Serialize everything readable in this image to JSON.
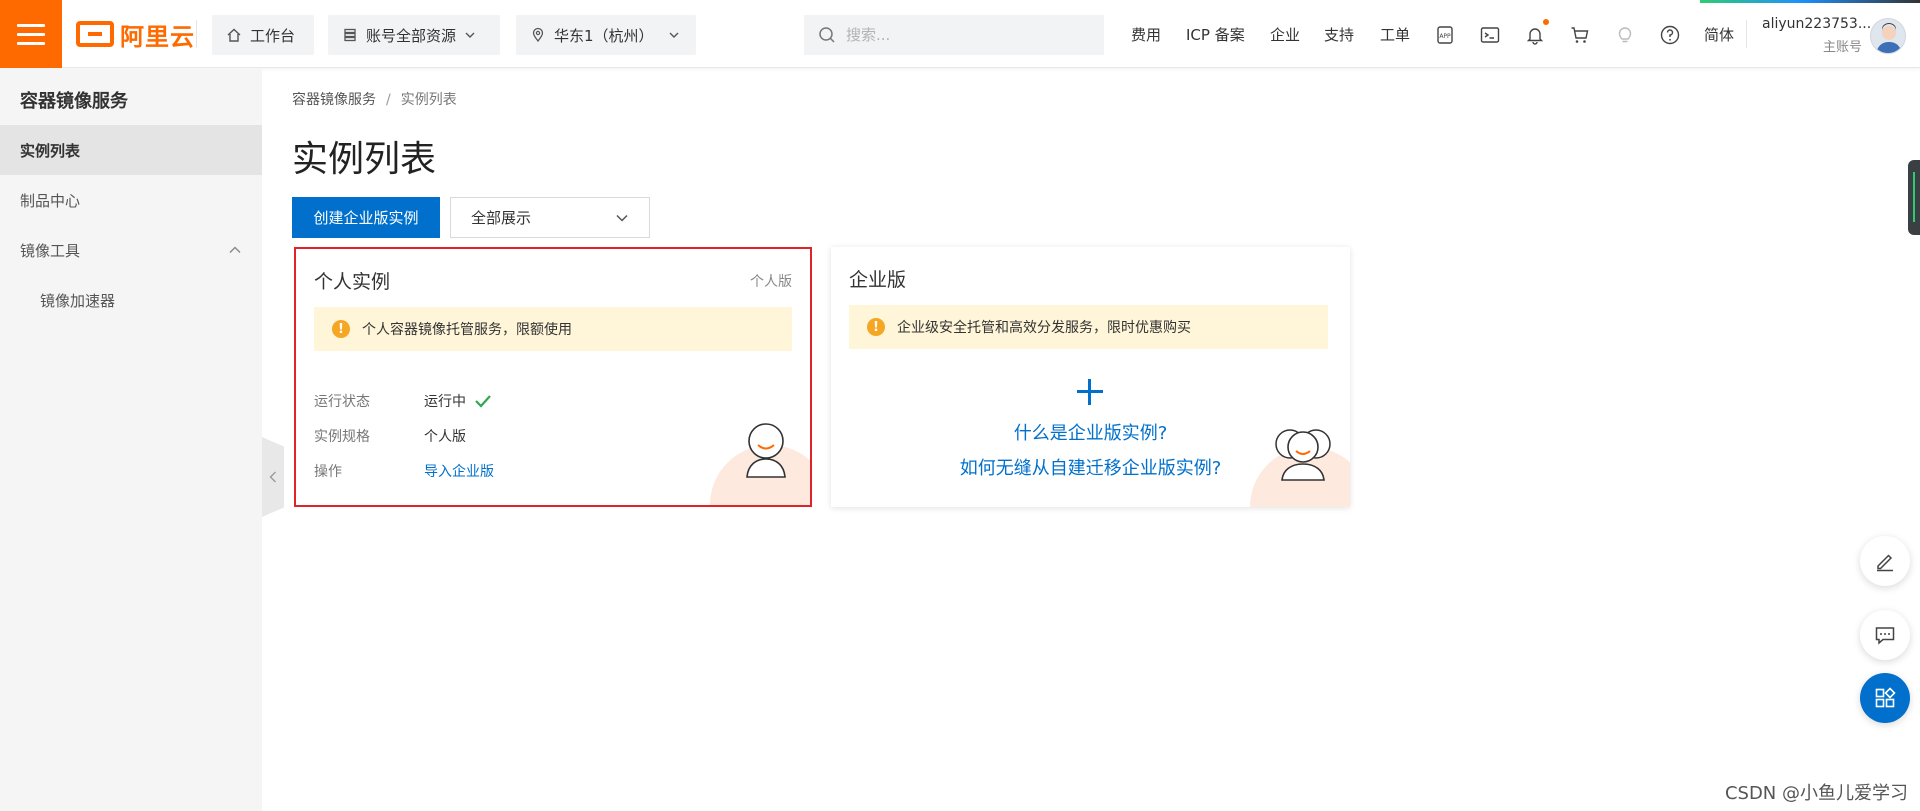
{
  "header": {
    "logo_text": "阿里云",
    "workbench_label": "工作台",
    "resources_label": "账号全部资源",
    "region_label": "华东1（杭州）",
    "search_placeholder": "搜索...",
    "nav_links": [
      "费用",
      "ICP 备案",
      "企业",
      "支持",
      "工单"
    ],
    "language_label": "简体",
    "user_name": "aliyun223753...",
    "user_role": "主账号",
    "accent_color": "#ff6a00"
  },
  "sidebar": {
    "title": "容器镜像服务",
    "items": [
      {
        "label": "实例列表",
        "active": true
      },
      {
        "label": "制品中心"
      },
      {
        "label": "镜像工具",
        "expanded": true
      },
      {
        "label": "镜像加速器",
        "sub": true
      }
    ]
  },
  "breadcrumb": {
    "root": "容器镜像服务",
    "separator": "/",
    "current": "实例列表"
  },
  "page": {
    "title": "实例列表",
    "create_button": "创建企业版实例",
    "filter_select": "全部展示"
  },
  "personal_card": {
    "title": "个人实例",
    "tag": "个人版",
    "notice": "个人容器镜像托管服务，限额使用",
    "status_label": "运行状态",
    "status_value": "运行中",
    "spec_label": "实例规格",
    "spec_value": "个人版",
    "action_label": "操作",
    "action_link": "导入企业版"
  },
  "enterprise_card": {
    "title": "企业版",
    "notice": "企业级安全托管和高效分发服务，限时优惠购买",
    "link_what": "什么是企业版实例?",
    "link_migrate": "如何无缝从自建迁移企业版实例?"
  },
  "watermark": "CSDN @小鱼儿爱学习"
}
